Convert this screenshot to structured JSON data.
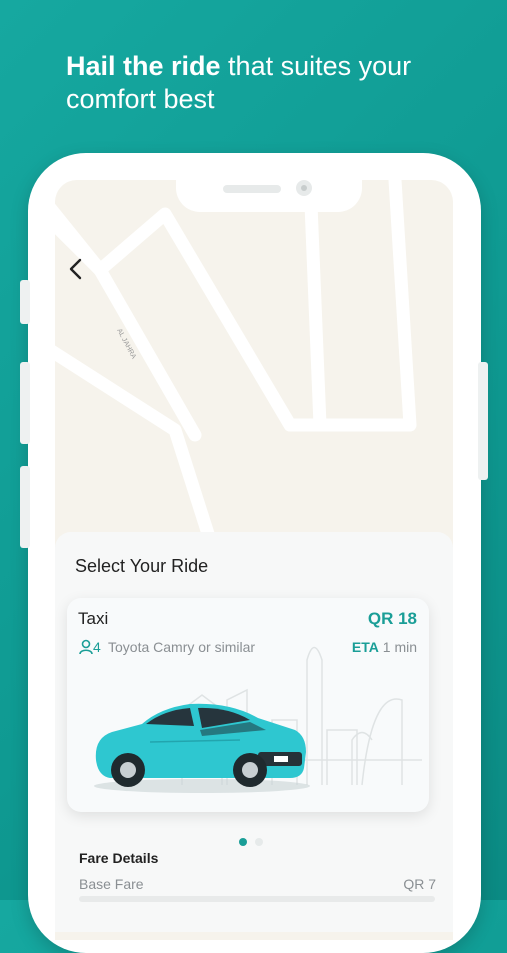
{
  "headline": {
    "bold": "Hail the ride",
    "rest": " that suites your comfort best"
  },
  "map": {
    "street_label": "AL JAHRA"
  },
  "sheet": {
    "title": "Select Your Ride",
    "ride": {
      "name": "Taxi",
      "price": "QR 18",
      "seats": "4",
      "model": "Toyota Camry or similar",
      "eta_label": "ETA",
      "eta_value": " 1 min"
    },
    "pager": {
      "pages": 2,
      "active": 0
    },
    "fare": {
      "title": "Fare Details",
      "base_label": "Base Fare",
      "base_value": "QR 7"
    }
  },
  "colors": {
    "brand": "#16a8a0",
    "accent_text": "#1a9e97",
    "car_body": "#2ec7d0"
  }
}
